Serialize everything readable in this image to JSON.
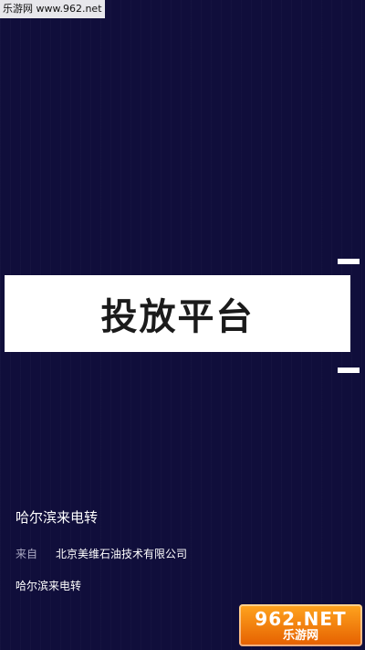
{
  "watermark": {
    "top_text": "乐游网 www.962.net",
    "logo_top": "962.NET",
    "logo_bottom": "乐游网"
  },
  "banner": {
    "title": "投放平台"
  },
  "call": {
    "name": "哈尔滨来电转",
    "from_label": "来自",
    "from_company": "北京美维石油技术有限公司",
    "line2": "哈尔滨来电转"
  },
  "colors": {
    "background": "#100e3b",
    "banner_bg": "#ffffff",
    "text_primary": "#ffffff",
    "text_secondary": "#a9a8c2",
    "logo_orange": "#f07a00"
  }
}
